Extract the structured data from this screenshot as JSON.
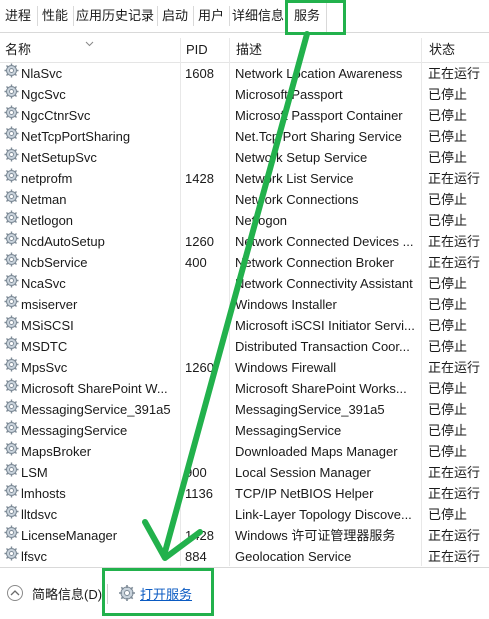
{
  "tabs": [
    "进程",
    "性能",
    "应用历史记录",
    "启动",
    "用户",
    "详细信息",
    "服务"
  ],
  "active_tab": "服务",
  "columns": {
    "name": "名称",
    "pid": "PID",
    "desc": "描述",
    "status": "状态"
  },
  "services": [
    {
      "name": "NlaSvc",
      "pid": "1608",
      "desc": "Network Location Awareness",
      "status": "正在运行"
    },
    {
      "name": "NgcSvc",
      "pid": "",
      "desc": "Microsoft Passport",
      "status": "已停止"
    },
    {
      "name": "NgcCtnrSvc",
      "pid": "",
      "desc": "Microsoft Passport Container",
      "status": "已停止"
    },
    {
      "name": "NetTcpPortSharing",
      "pid": "",
      "desc": "Net.Tcp Port Sharing Service",
      "status": "已停止"
    },
    {
      "name": "NetSetupSvc",
      "pid": "",
      "desc": "Network Setup Service",
      "status": "已停止"
    },
    {
      "name": "netprofm",
      "pid": "1428",
      "desc": "Network List Service",
      "status": "正在运行"
    },
    {
      "name": "Netman",
      "pid": "",
      "desc": "Network Connections",
      "status": "已停止"
    },
    {
      "name": "Netlogon",
      "pid": "",
      "desc": "Netlogon",
      "status": "已停止"
    },
    {
      "name": "NcdAutoSetup",
      "pid": "1260",
      "desc": "Network Connected Devices ...",
      "status": "正在运行"
    },
    {
      "name": "NcbService",
      "pid": "400",
      "desc": "Network Connection Broker",
      "status": "正在运行"
    },
    {
      "name": "NcaSvc",
      "pid": "",
      "desc": "Network Connectivity Assistant",
      "status": "已停止"
    },
    {
      "name": "msiserver",
      "pid": "",
      "desc": "Windows Installer",
      "status": "已停止"
    },
    {
      "name": "MSiSCSI",
      "pid": "",
      "desc": "Microsoft iSCSI Initiator Servi...",
      "status": "已停止"
    },
    {
      "name": "MSDTC",
      "pid": "",
      "desc": "Distributed Transaction Coor...",
      "status": "已停止"
    },
    {
      "name": "MpsSvc",
      "pid": "1260",
      "desc": "Windows Firewall",
      "status": "正在运行"
    },
    {
      "name": "Microsoft SharePoint W...",
      "pid": "",
      "desc": "Microsoft SharePoint Works...",
      "status": "已停止"
    },
    {
      "name": "MessagingService_391a5",
      "pid": "",
      "desc": "MessagingService_391a5",
      "status": "已停止"
    },
    {
      "name": "MessagingService",
      "pid": "",
      "desc": "MessagingService",
      "status": "已停止"
    },
    {
      "name": "MapsBroker",
      "pid": "",
      "desc": "Downloaded Maps Manager",
      "status": "已停止"
    },
    {
      "name": "LSM",
      "pid": "900",
      "desc": "Local Session Manager",
      "status": "正在运行"
    },
    {
      "name": "lmhosts",
      "pid": "1136",
      "desc": "TCP/IP NetBIOS Helper",
      "status": "正在运行"
    },
    {
      "name": "lltdsvc",
      "pid": "",
      "desc": "Link-Layer Topology Discove...",
      "status": "已停止"
    },
    {
      "name": "LicenseManager",
      "pid": "1428",
      "desc": "Windows 许可证管理器服务",
      "status": "正在运行"
    },
    {
      "name": "lfsvc",
      "pid": "884",
      "desc": "Geolocation Service",
      "status": "正在运行"
    }
  ],
  "footer": {
    "brief": "简略信息(D)",
    "open_services": "打开服务"
  },
  "colors": {
    "annotation": "#22b14c",
    "link": "#0a5ac2"
  }
}
